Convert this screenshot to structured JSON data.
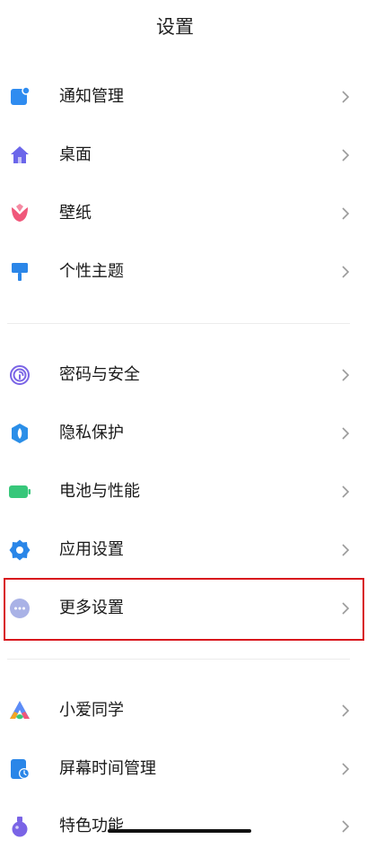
{
  "header": {
    "title": "设置"
  },
  "items": [
    {
      "label": "通知管理",
      "icon": "notification-icon",
      "color": "#2f8cf0"
    },
    {
      "label": "桌面",
      "icon": "home-icon",
      "color": "#6b66ea"
    },
    {
      "label": "壁纸",
      "icon": "tulip-icon",
      "color": "#f0577a"
    },
    {
      "label": "个性主题",
      "icon": "paint-brush-icon",
      "color": "#2b86e8"
    },
    {
      "label": "密码与安全",
      "icon": "fingerprint-icon",
      "color": "#7a64e6"
    },
    {
      "label": "隐私保护",
      "icon": "privacy-shield-icon",
      "color": "#2a8ee8"
    },
    {
      "label": "电池与性能",
      "icon": "battery-icon",
      "color": "#37c77a"
    },
    {
      "label": "应用设置",
      "icon": "gear-icon",
      "color": "#2a86e8"
    },
    {
      "label": "更多设置",
      "icon": "more-dots-icon",
      "color": "#8f9bdc"
    },
    {
      "label": "小爱同学",
      "icon": "xiaoai-icon",
      "color": "#5c8cf7"
    },
    {
      "label": "屏幕时间管理",
      "icon": "screen-time-icon",
      "color": "#2a86e8"
    },
    {
      "label": "特色功能",
      "icon": "potion-icon",
      "color": "#7a64e6"
    }
  ],
  "highlight": {
    "color": "#d8141c",
    "target": "更多设置"
  }
}
